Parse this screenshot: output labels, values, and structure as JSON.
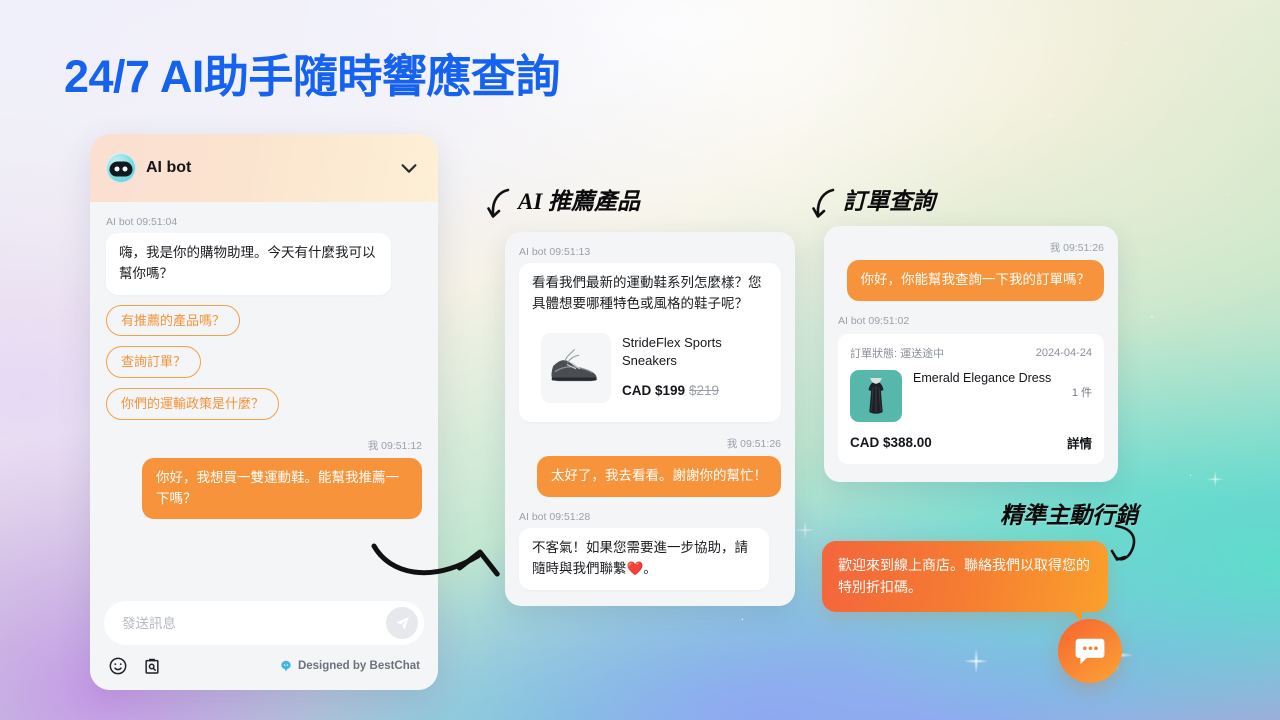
{
  "page": {
    "title": "24/7 AI助手隨時響應查詢",
    "title_color": "#1662f0"
  },
  "chat_widget": {
    "header": {
      "bot_name": "AI bot",
      "avatar_icon": "robot-avatar-icon",
      "collapse_icon": "chevron-down-icon"
    },
    "messages": [
      {
        "sender": "bot",
        "meta": "AI bot 09:51:04",
        "text": "嗨，我是你的購物助理。今天有什麼我可以幫你嗎？"
      },
      {
        "sender": "user",
        "meta": "我 09:51:12",
        "text": "你好，我想買一雙運動鞋。能幫我推薦一下嗎？"
      }
    ],
    "quick_replies": [
      "有推薦的產品嗎？",
      "查詢訂單？",
      "你們的運輸政策是什麼？"
    ],
    "composer": {
      "placeholder": "發送訊息",
      "value": "",
      "send_icon": "send-paper-plane-icon",
      "emoji_icon": "emoji-smiley-icon",
      "knowledge_icon": "search-clipboard-icon",
      "brand_text": "Designed by BestChat",
      "brand_icon": "bestchat-logo-icon"
    },
    "accent_color": "#f7933a"
  },
  "annotations": {
    "recommend": "AI 推薦產品",
    "order": "訂單查詢",
    "marketing": "精準主動行銷"
  },
  "card_recommend": {
    "meta": "AI bot 09:51:13",
    "bot_text": "看看我們最新的運動鞋系列怎麼樣？您具體想要哪種特色或風格的鞋子呢？",
    "product": {
      "name": "StrideFlex Sports Sneakers",
      "price": "CAD $199",
      "old_price": "$219",
      "image_icon": "sneaker-photo"
    },
    "user_meta": "我 09:51:26",
    "user_text": "太好了，我去看看。謝謝你的幫忙！",
    "bot_meta2": "AI bot 09:51:28",
    "bot_text2": "不客氣！如果您需要進一步協助，請隨時與我們聯繫❤️。"
  },
  "card_order": {
    "user_meta": "我 09:51:26",
    "user_text": "你好，你能幫我查詢一下我的訂單嗎？",
    "bot_meta": "AI bot 09:51:02",
    "status_label": "訂單狀態: 運送途中",
    "date": "2024-04-24",
    "item_name": "Emerald Elegance Dress",
    "item_qty": "1 件",
    "item_image_icon": "green-dress-photo",
    "total": "CAD $388.00",
    "detail_link": "詳情"
  },
  "marketing": {
    "text": "歡迎來到線上商店。聯絡我們以取得您的特別折扣碼。",
    "launcher_icon": "chat-bubble-icon",
    "gradient_from": "#f4653c",
    "gradient_to": "#fb9f2c"
  }
}
